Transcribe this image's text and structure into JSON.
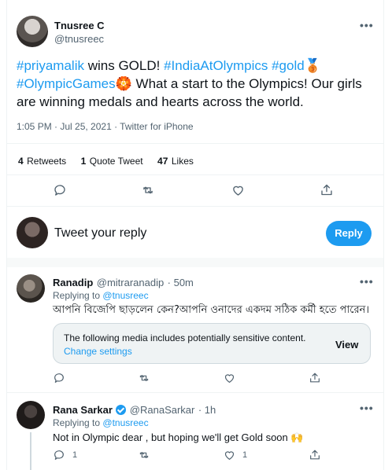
{
  "main_tweet": {
    "author_name": "Tnusree C",
    "author_handle": "@tnusreec",
    "text_parts": [
      {
        "t": "#priyamalik",
        "tag": true
      },
      {
        "t": " wins GOLD! ",
        "tag": false
      },
      {
        "t": "#IndiaAtOlympics",
        "tag": true
      },
      {
        "t": " ",
        "tag": false
      },
      {
        "t": "#gold",
        "tag": true
      },
      {
        "t": "🥉",
        "tag": false
      },
      {
        "t": " ",
        "tag": false
      },
      {
        "t": "#OlympicGames",
        "tag": true
      },
      {
        "t": "🏵️",
        "tag": false
      },
      {
        "t": " What a start to the Olympics! Our girls are winning medals and hearts across the world.",
        "tag": false
      }
    ],
    "timestamp": "1:05 PM · Jul 25, 2021 · Twitter for iPhone",
    "retweets_count": "4",
    "retweets_label": "Retweets",
    "quotes_count": "1",
    "quotes_label": "Quote Tweet",
    "likes_count": "47",
    "likes_label": "Likes"
  },
  "compose": {
    "placeholder": "Tweet your reply",
    "reply_button": "Reply"
  },
  "replies": [
    {
      "name": "Ranadip",
      "handle": "@mitraranadip",
      "time": "· 50m",
      "replying_label": "Replying to",
      "replying_to": "@tnusreec",
      "text": "আপনি বিজেপি ছাড়লেন কেন?আপনি ওনাদের একদম সঠিক কর্মী হতে পারেন।",
      "sensitive_text": "The following media includes potentially sensitive content.",
      "change_settings": "Change settings",
      "view_label": "View"
    },
    {
      "name": "Rana Sarkar",
      "handle": "@RanaSarkar",
      "time": "· 1h",
      "replying_label": "Replying to",
      "replying_to": "@tnusreec",
      "text": "Not in Olympic dear , but hoping we'll get Gold soon 🙌",
      "reply_count": "1",
      "like_count": "1"
    }
  ],
  "icons": {
    "more": "more-icon",
    "reply": "reply-icon",
    "retweet": "retweet-icon",
    "like": "heart-icon",
    "share": "share-icon",
    "verified": "verified-badge-icon"
  },
  "colors": {
    "accent": "#1d9bf0",
    "text": "#0f1419",
    "muted": "#536471",
    "border": "#eff3f4"
  }
}
